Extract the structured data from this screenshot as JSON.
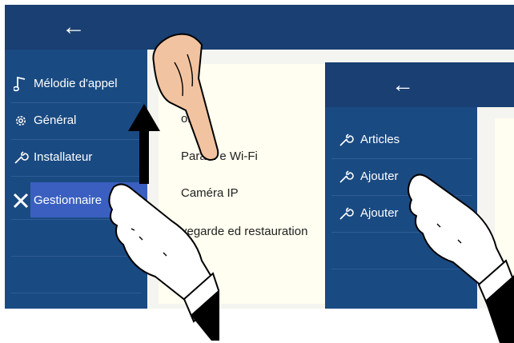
{
  "left_screen": {
    "back_icon": "arrow-left-icon",
    "sidebar": [
      {
        "icon": "music-note-icon",
        "glyph": "♪",
        "label": "Mélodie d'appel"
      },
      {
        "icon": "gear-icon",
        "glyph": "⚙",
        "label": "Général"
      },
      {
        "icon": "wrench-icon",
        "glyph": "🔧",
        "label": "Installateur"
      },
      {
        "icon": "tools-icon",
        "glyph": "✂",
        "label": "Gestionnaire"
      }
    ],
    "content": [
      "onfig.",
      "Param    e Wi-Fi",
      "Caméra IP",
      "vegarde ed restauration"
    ]
  },
  "right_screen": {
    "back_icon": "arrow-left-icon",
    "sidebar": [
      {
        "icon": "wrench-icon",
        "glyph": "🔧",
        "label": "Articles"
      },
      {
        "icon": "wrench-icon",
        "glyph": "🔧",
        "label": "Ajouter"
      },
      {
        "icon": "wrench-icon",
        "glyph": "🔧",
        "label": "Ajouter"
      }
    ]
  },
  "colors": {
    "header": "#1a3f72",
    "sidebar": "#1a4a82",
    "highlight": "#3a5fc0",
    "card": "#fffef0"
  },
  "gestures": [
    "swipe-up-hand-icon",
    "tap-hand-icon",
    "tap-hand-icon"
  ]
}
